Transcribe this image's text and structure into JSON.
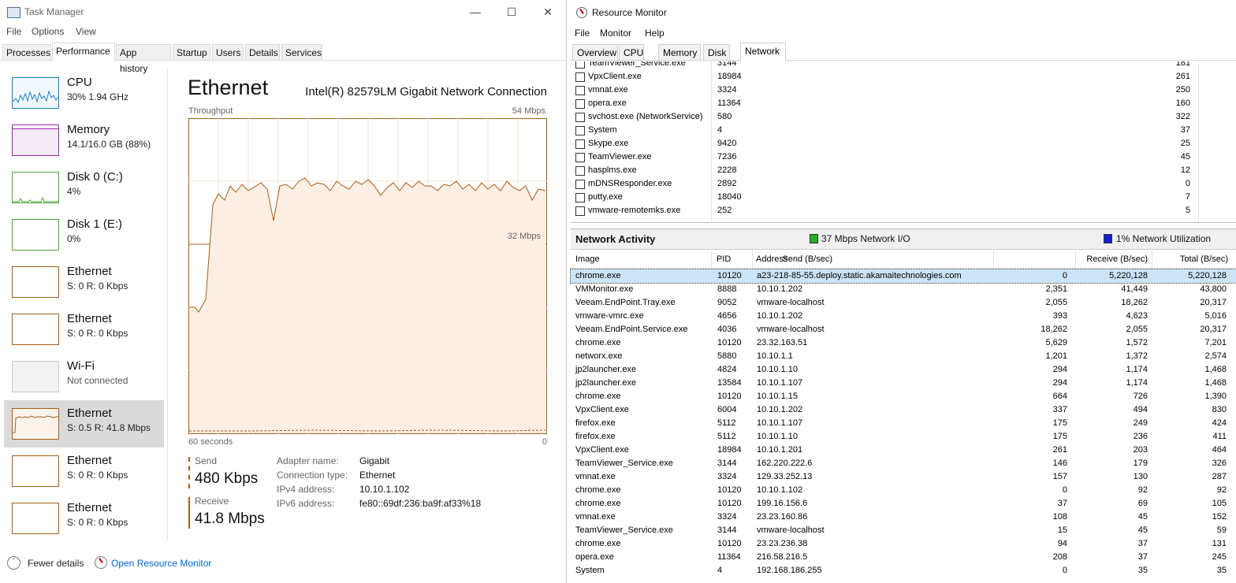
{
  "task_manager": {
    "title": "Task Manager",
    "menu": [
      "File",
      "Options",
      "View"
    ],
    "tabs": [
      "Processes",
      "Performance",
      "App history",
      "Startup",
      "Users",
      "Details",
      "Services"
    ],
    "active_tab": "Performance",
    "sidebar": [
      {
        "name": "CPU",
        "sub": "30% 1.94 GHz",
        "color": "#1a7fc1"
      },
      {
        "name": "Memory",
        "sub": "14.1/16.0 GB (88%)",
        "color": "#9b2ba3"
      },
      {
        "name": "Disk 0 (C:)",
        "sub": "4%",
        "color": "#4da630"
      },
      {
        "name": "Disk 1 (E:)",
        "sub": "0%",
        "color": "#4da630"
      },
      {
        "name": "Ethernet",
        "sub": "S: 0 R: 0 Kbps",
        "color": "#a75e18"
      },
      {
        "name": "Ethernet",
        "sub": "S: 0 R: 0 Kbps",
        "color": "#a75e18"
      },
      {
        "name": "Wi-Fi",
        "sub": "Not connected",
        "color": "#bbbbbb"
      },
      {
        "name": "Ethernet",
        "sub": "S: 0.5 R: 41.8 Mbps",
        "color": "#a75e18"
      },
      {
        "name": "Ethernet",
        "sub": "S: 0 R: 0 Kbps",
        "color": "#a75e18"
      },
      {
        "name": "Ethernet",
        "sub": "S: 0 R: 0 Kbps",
        "color": "#a75e18"
      }
    ],
    "main": {
      "title": "Ethernet",
      "adapter": "Intel(R) 82579LM Gigabit Network Connection",
      "throughput_label": "Throughput",
      "max_label": "54 Mbps",
      "mid_label": "32 Mbps",
      "time_label": "60 seconds",
      "zero_label": "0",
      "send_label": "Send",
      "send_value": "480 Kbps",
      "receive_label": "Receive",
      "receive_value": "41.8 Mbps",
      "props": [
        {
          "k": "Adapter name:",
          "v": "Gigabit"
        },
        {
          "k": "Connection type:",
          "v": "Ethernet"
        },
        {
          "k": "IPv4 address:",
          "v": "10.10.1.102"
        },
        {
          "k": "IPv6 address:",
          "v": "fe80::69df:236:ba9f:af33%18"
        }
      ]
    },
    "footer": {
      "fewer": "Fewer details",
      "open_rm": "Open Resource Monitor"
    }
  },
  "resource_monitor": {
    "title": "Resource Monitor",
    "menu": [
      "File",
      "Monitor",
      "Help"
    ],
    "tabs": [
      "Overview",
      "CPU",
      "Memory",
      "Disk",
      "Network"
    ],
    "active_tab": "Network",
    "processes": [
      {
        "name": "TeamViewer_Service.exe",
        "pid": "3144",
        "val": "181"
      },
      {
        "name": "VpxClient.exe",
        "pid": "18984",
        "val": "261"
      },
      {
        "name": "vmnat.exe",
        "pid": "3324",
        "val": "250"
      },
      {
        "name": "opera.exe",
        "pid": "11364",
        "val": "160"
      },
      {
        "name": "svchost.exe (NetworkService)",
        "pid": "580",
        "val": "322"
      },
      {
        "name": "System",
        "pid": "4",
        "val": "37"
      },
      {
        "name": "Skype.exe",
        "pid": "9420",
        "val": "25"
      },
      {
        "name": "TeamViewer.exe",
        "pid": "7236",
        "val": "45"
      },
      {
        "name": "hasplms.exe",
        "pid": "2228",
        "val": "12"
      },
      {
        "name": "mDNSResponder.exe",
        "pid": "2892",
        "val": "0"
      },
      {
        "name": "putty.exe",
        "pid": "18040",
        "val": "7"
      },
      {
        "name": "vmware-remotemks.exe",
        "pid": "252",
        "val": "5"
      }
    ],
    "network_activity": {
      "title": "Network Activity",
      "io": "37 Mbps Network I/O",
      "io_color": "#21b121",
      "util": "1% Network Utilization",
      "util_color": "#1020d0"
    },
    "columns": [
      "Image",
      "PID",
      "Address",
      "Send (B/sec)",
      "Receive (B/sec)",
      "Total (B/sec)"
    ],
    "rows": [
      [
        "chrome.exe",
        "10120",
        "a23-218-85-55.deploy.static.akamaitechnologies.com",
        "0",
        "5,220,128",
        "5,220,128"
      ],
      [
        "VMMonitor.exe",
        "8888",
        "10.10.1.202",
        "2,351",
        "41,449",
        "43,800"
      ],
      [
        "Veeam.EndPoint.Tray.exe",
        "9052",
        "vmware-localhost",
        "2,055",
        "18,262",
        "20,317"
      ],
      [
        "vmware-vmrc.exe",
        "4656",
        "10.10.1.202",
        "393",
        "4,623",
        "5,016"
      ],
      [
        "Veeam.EndPoint.Service.exe",
        "4036",
        "vmware-localhost",
        "18,262",
        "2,055",
        "20,317"
      ],
      [
        "chrome.exe",
        "10120",
        "23.32.163.51",
        "5,629",
        "1,572",
        "7,201"
      ],
      [
        "networx.exe",
        "5880",
        "10.10.1.1",
        "1,201",
        "1,372",
        "2,574"
      ],
      [
        "jp2launcher.exe",
        "4824",
        "10.10.1.10",
        "294",
        "1,174",
        "1,468"
      ],
      [
        "jp2launcher.exe",
        "13584",
        "10.10.1.107",
        "294",
        "1,174",
        "1,468"
      ],
      [
        "chrome.exe",
        "10120",
        "10.10.1.15",
        "664",
        "726",
        "1,390"
      ],
      [
        "VpxClient.exe",
        "6004",
        "10.10.1.202",
        "337",
        "494",
        "830"
      ],
      [
        "firefox.exe",
        "5112",
        "10.10.1.107",
        "175",
        "249",
        "424"
      ],
      [
        "firefox.exe",
        "5112",
        "10.10.1.10",
        "175",
        "236",
        "411"
      ],
      [
        "VpxClient.exe",
        "18984",
        "10.10.1.201",
        "261",
        "203",
        "464"
      ],
      [
        "TeamViewer_Service.exe",
        "3144",
        "162.220.222.6",
        "146",
        "179",
        "326"
      ],
      [
        "vmnat.exe",
        "3324",
        "129.33.252.13",
        "157",
        "130",
        "287"
      ],
      [
        "chrome.exe",
        "10120",
        "10.10.1.102",
        "0",
        "92",
        "92"
      ],
      [
        "chrome.exe",
        "10120",
        "199.16.156.6",
        "37",
        "69",
        "105"
      ],
      [
        "vmnat.exe",
        "3324",
        "23.23.160.86",
        "108",
        "45",
        "152"
      ],
      [
        "TeamViewer_Service.exe",
        "3144",
        "vmware-localhost",
        "15",
        "45",
        "59"
      ],
      [
        "chrome.exe",
        "10120",
        "23.23.236.38",
        "94",
        "37",
        "131"
      ],
      [
        "opera.exe",
        "11364",
        "216.58.216.5",
        "208",
        "37",
        "245"
      ],
      [
        "System",
        "4",
        "192.168.186.255",
        "0",
        "35",
        "35"
      ]
    ]
  }
}
